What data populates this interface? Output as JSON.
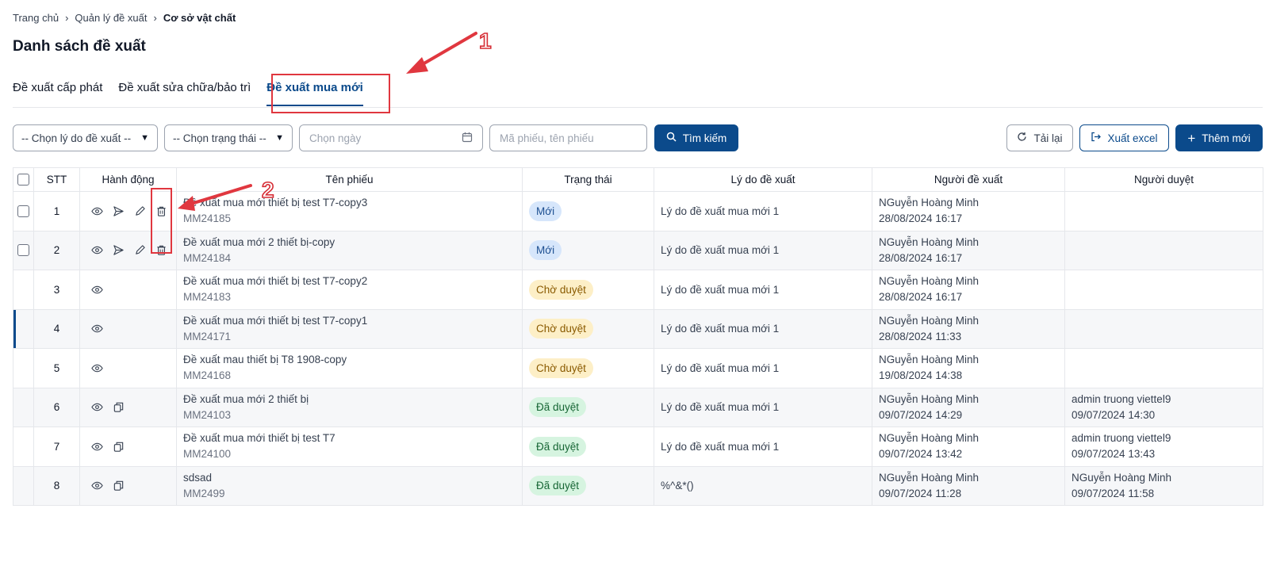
{
  "breadcrumb": {
    "home": "Trang chủ",
    "section": "Quản lý đề xuất",
    "current": "Cơ sở vật chất"
  },
  "page_title": "Danh sách đề xuất",
  "tabs": [
    {
      "label": "Đề xuất cấp phát"
    },
    {
      "label": "Đề xuất sửa chữa/bảo trì"
    },
    {
      "label": "Đề xuất mua mới"
    }
  ],
  "filters": {
    "reason_select": "-- Chọn lý do đề xuất --",
    "status_select": "-- Chọn trạng thái --",
    "date_placeholder": "Chọn ngày",
    "search_placeholder": "Mã phiếu, tên phiếu",
    "search_button": "Tìm kiếm",
    "reload_button": "Tải lại",
    "export_button": "Xuất excel",
    "add_button": "Thêm mới"
  },
  "table": {
    "headers": {
      "stt": "STT",
      "actions": "Hành động",
      "name": "Tên phiếu",
      "status": "Trạng thái",
      "reason": "Lý do đề xuất",
      "proposer": "Người đề xuất",
      "approver": "Người duyệt"
    },
    "rows": [
      {
        "stt": "1",
        "name": "Đề xuất mua mới thiết bị test T7-copy3",
        "code": "MM24185",
        "status": "Mới",
        "reason": "Lý do đề xuất mua mới 1",
        "proposer": "NGuyễn Hoàng Minh",
        "proposer_time": "28/08/2024 16:17",
        "approver": "",
        "approver_time": ""
      },
      {
        "stt": "2",
        "name": "Đề xuất mua mới 2 thiết bị-copy",
        "code": "MM24184",
        "status": "Mới",
        "reason": "Lý do đề xuất mua mới 1",
        "proposer": "NGuyễn Hoàng Minh",
        "proposer_time": "28/08/2024 16:17",
        "approver": "",
        "approver_time": ""
      },
      {
        "stt": "3",
        "name": "Đề xuất mua mới thiết bị test T7-copy2",
        "code": "MM24183",
        "status": "Chờ duyệt",
        "reason": "Lý do đề xuất mua mới 1",
        "proposer": "NGuyễn Hoàng Minh",
        "proposer_time": "28/08/2024 16:17",
        "approver": "",
        "approver_time": ""
      },
      {
        "stt": "4",
        "name": "Đề xuất mua mới thiết bị test T7-copy1",
        "code": "MM24171",
        "status": "Chờ duyệt",
        "reason": "Lý do đề xuất mua mới 1",
        "proposer": "NGuyễn Hoàng Minh",
        "proposer_time": "28/08/2024 11:33",
        "approver": "",
        "approver_time": ""
      },
      {
        "stt": "5",
        "name": "Đề xuất mau thiết bị T8 1908-copy",
        "code": "MM24168",
        "status": "Chờ duyệt",
        "reason": "Lý do đề xuất mua mới 1",
        "proposer": "NGuyễn Hoàng Minh",
        "proposer_time": "19/08/2024 14:38",
        "approver": "",
        "approver_time": ""
      },
      {
        "stt": "6",
        "name": "Đề xuất mua mới 2 thiết bị",
        "code": "MM24103",
        "status": "Đã duyệt",
        "reason": "Lý do đề xuất mua mới 1",
        "proposer": "NGuyễn Hoàng Minh",
        "proposer_time": "09/07/2024 14:29",
        "approver": "admin truong viettel9",
        "approver_time": "09/07/2024 14:30"
      },
      {
        "stt": "7",
        "name": "Đề xuất mua mới thiết bị test T7",
        "code": "MM24100",
        "status": "Đã duyệt",
        "reason": "Lý do đề xuất mua mới 1",
        "proposer": "NGuyễn Hoàng Minh",
        "proposer_time": "09/07/2024 13:42",
        "approver": "admin truong viettel9",
        "approver_time": "09/07/2024 13:43"
      },
      {
        "stt": "8",
        "name": "sdsad",
        "code": "MM2499",
        "status": "Đã duyệt",
        "reason": "%^&*()",
        "proposer": "NGuyễn Hoàng Minh",
        "proposer_time": "09/07/2024 11:28",
        "approver": "NGuyễn Hoàng Minh",
        "approver_time": "09/07/2024 11:58"
      }
    ]
  },
  "annotations": {
    "marker_1": "1",
    "marker_2": "2"
  },
  "colors": {
    "primary": "#0b4a8b",
    "annotation": "#e0373f",
    "badge_new": "#d6e6fb",
    "badge_pending": "#fdefc7",
    "badge_approved": "#d6f4e0"
  },
  "icons": [
    "eye-icon",
    "send-icon",
    "pencil-icon",
    "trash-icon",
    "copy-icon",
    "search-icon",
    "refresh-icon",
    "export-icon",
    "plus-icon",
    "calendar-icon",
    "chevron-down-icon"
  ]
}
